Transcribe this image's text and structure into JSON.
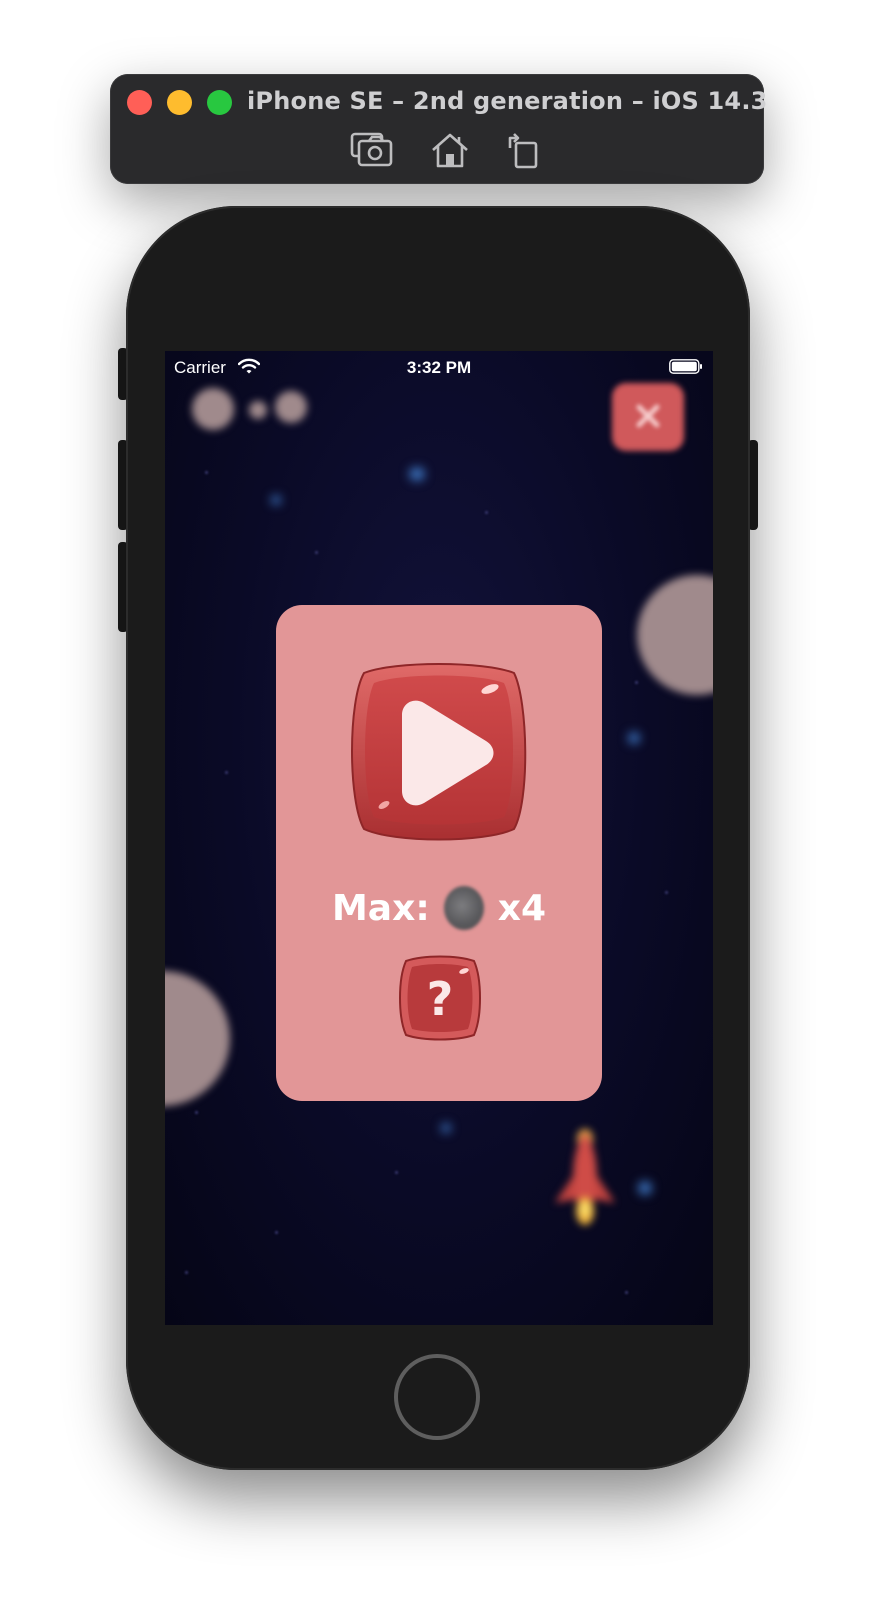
{
  "simulator": {
    "title": "iPhone SE – 2nd generation – iOS 14.3",
    "toolbar": [
      "screenshot-icon",
      "home-icon",
      "rotate-icon"
    ]
  },
  "status_bar": {
    "carrier": "Carrier",
    "time": "3:32 PM"
  },
  "menu": {
    "max_label": "Max:",
    "max_value": "x4",
    "help_symbol": "?"
  },
  "colors": {
    "panel": "#e29697",
    "button_red": "#c94446",
    "space_bg": "#0a0a26"
  }
}
